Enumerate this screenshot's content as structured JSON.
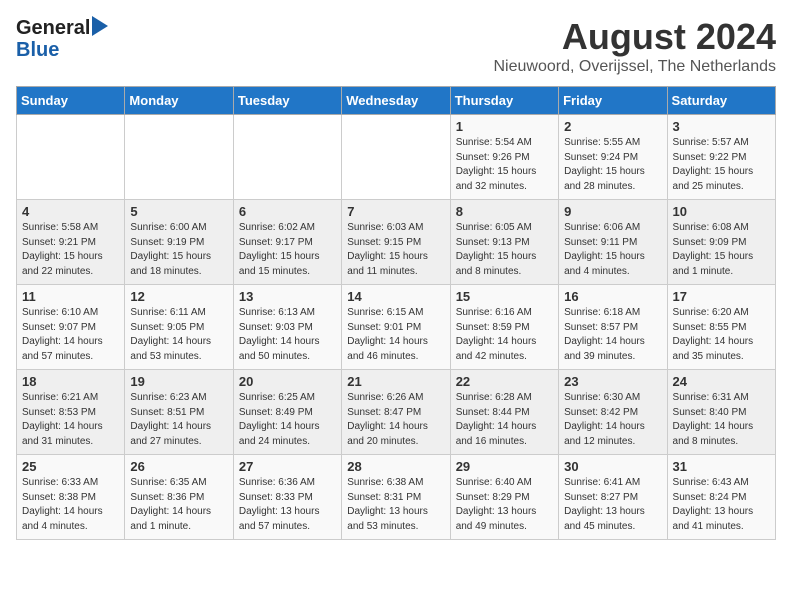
{
  "header": {
    "logo_general": "General",
    "logo_blue": "Blue",
    "month_year": "August 2024",
    "location": "Nieuwoord, Overijssel, The Netherlands"
  },
  "days_of_week": [
    "Sunday",
    "Monday",
    "Tuesday",
    "Wednesday",
    "Thursday",
    "Friday",
    "Saturday"
  ],
  "weeks": [
    [
      {
        "day": "",
        "content": ""
      },
      {
        "day": "",
        "content": ""
      },
      {
        "day": "",
        "content": ""
      },
      {
        "day": "",
        "content": ""
      },
      {
        "day": "1",
        "content": "Sunrise: 5:54 AM\nSunset: 9:26 PM\nDaylight: 15 hours\nand 32 minutes."
      },
      {
        "day": "2",
        "content": "Sunrise: 5:55 AM\nSunset: 9:24 PM\nDaylight: 15 hours\nand 28 minutes."
      },
      {
        "day": "3",
        "content": "Sunrise: 5:57 AM\nSunset: 9:22 PM\nDaylight: 15 hours\nand 25 minutes."
      }
    ],
    [
      {
        "day": "4",
        "content": "Sunrise: 5:58 AM\nSunset: 9:21 PM\nDaylight: 15 hours\nand 22 minutes."
      },
      {
        "day": "5",
        "content": "Sunrise: 6:00 AM\nSunset: 9:19 PM\nDaylight: 15 hours\nand 18 minutes."
      },
      {
        "day": "6",
        "content": "Sunrise: 6:02 AM\nSunset: 9:17 PM\nDaylight: 15 hours\nand 15 minutes."
      },
      {
        "day": "7",
        "content": "Sunrise: 6:03 AM\nSunset: 9:15 PM\nDaylight: 15 hours\nand 11 minutes."
      },
      {
        "day": "8",
        "content": "Sunrise: 6:05 AM\nSunset: 9:13 PM\nDaylight: 15 hours\nand 8 minutes."
      },
      {
        "day": "9",
        "content": "Sunrise: 6:06 AM\nSunset: 9:11 PM\nDaylight: 15 hours\nand 4 minutes."
      },
      {
        "day": "10",
        "content": "Sunrise: 6:08 AM\nSunset: 9:09 PM\nDaylight: 15 hours\nand 1 minute."
      }
    ],
    [
      {
        "day": "11",
        "content": "Sunrise: 6:10 AM\nSunset: 9:07 PM\nDaylight: 14 hours\nand 57 minutes."
      },
      {
        "day": "12",
        "content": "Sunrise: 6:11 AM\nSunset: 9:05 PM\nDaylight: 14 hours\nand 53 minutes."
      },
      {
        "day": "13",
        "content": "Sunrise: 6:13 AM\nSunset: 9:03 PM\nDaylight: 14 hours\nand 50 minutes."
      },
      {
        "day": "14",
        "content": "Sunrise: 6:15 AM\nSunset: 9:01 PM\nDaylight: 14 hours\nand 46 minutes."
      },
      {
        "day": "15",
        "content": "Sunrise: 6:16 AM\nSunset: 8:59 PM\nDaylight: 14 hours\nand 42 minutes."
      },
      {
        "day": "16",
        "content": "Sunrise: 6:18 AM\nSunset: 8:57 PM\nDaylight: 14 hours\nand 39 minutes."
      },
      {
        "day": "17",
        "content": "Sunrise: 6:20 AM\nSunset: 8:55 PM\nDaylight: 14 hours\nand 35 minutes."
      }
    ],
    [
      {
        "day": "18",
        "content": "Sunrise: 6:21 AM\nSunset: 8:53 PM\nDaylight: 14 hours\nand 31 minutes."
      },
      {
        "day": "19",
        "content": "Sunrise: 6:23 AM\nSunset: 8:51 PM\nDaylight: 14 hours\nand 27 minutes."
      },
      {
        "day": "20",
        "content": "Sunrise: 6:25 AM\nSunset: 8:49 PM\nDaylight: 14 hours\nand 24 minutes."
      },
      {
        "day": "21",
        "content": "Sunrise: 6:26 AM\nSunset: 8:47 PM\nDaylight: 14 hours\nand 20 minutes."
      },
      {
        "day": "22",
        "content": "Sunrise: 6:28 AM\nSunset: 8:44 PM\nDaylight: 14 hours\nand 16 minutes."
      },
      {
        "day": "23",
        "content": "Sunrise: 6:30 AM\nSunset: 8:42 PM\nDaylight: 14 hours\nand 12 minutes."
      },
      {
        "day": "24",
        "content": "Sunrise: 6:31 AM\nSunset: 8:40 PM\nDaylight: 14 hours\nand 8 minutes."
      }
    ],
    [
      {
        "day": "25",
        "content": "Sunrise: 6:33 AM\nSunset: 8:38 PM\nDaylight: 14 hours\nand 4 minutes."
      },
      {
        "day": "26",
        "content": "Sunrise: 6:35 AM\nSunset: 8:36 PM\nDaylight: 14 hours\nand 1 minute."
      },
      {
        "day": "27",
        "content": "Sunrise: 6:36 AM\nSunset: 8:33 PM\nDaylight: 13 hours\nand 57 minutes."
      },
      {
        "day": "28",
        "content": "Sunrise: 6:38 AM\nSunset: 8:31 PM\nDaylight: 13 hours\nand 53 minutes."
      },
      {
        "day": "29",
        "content": "Sunrise: 6:40 AM\nSunset: 8:29 PM\nDaylight: 13 hours\nand 49 minutes."
      },
      {
        "day": "30",
        "content": "Sunrise: 6:41 AM\nSunset: 8:27 PM\nDaylight: 13 hours\nand 45 minutes."
      },
      {
        "day": "31",
        "content": "Sunrise: 6:43 AM\nSunset: 8:24 PM\nDaylight: 13 hours\nand 41 minutes."
      }
    ]
  ]
}
